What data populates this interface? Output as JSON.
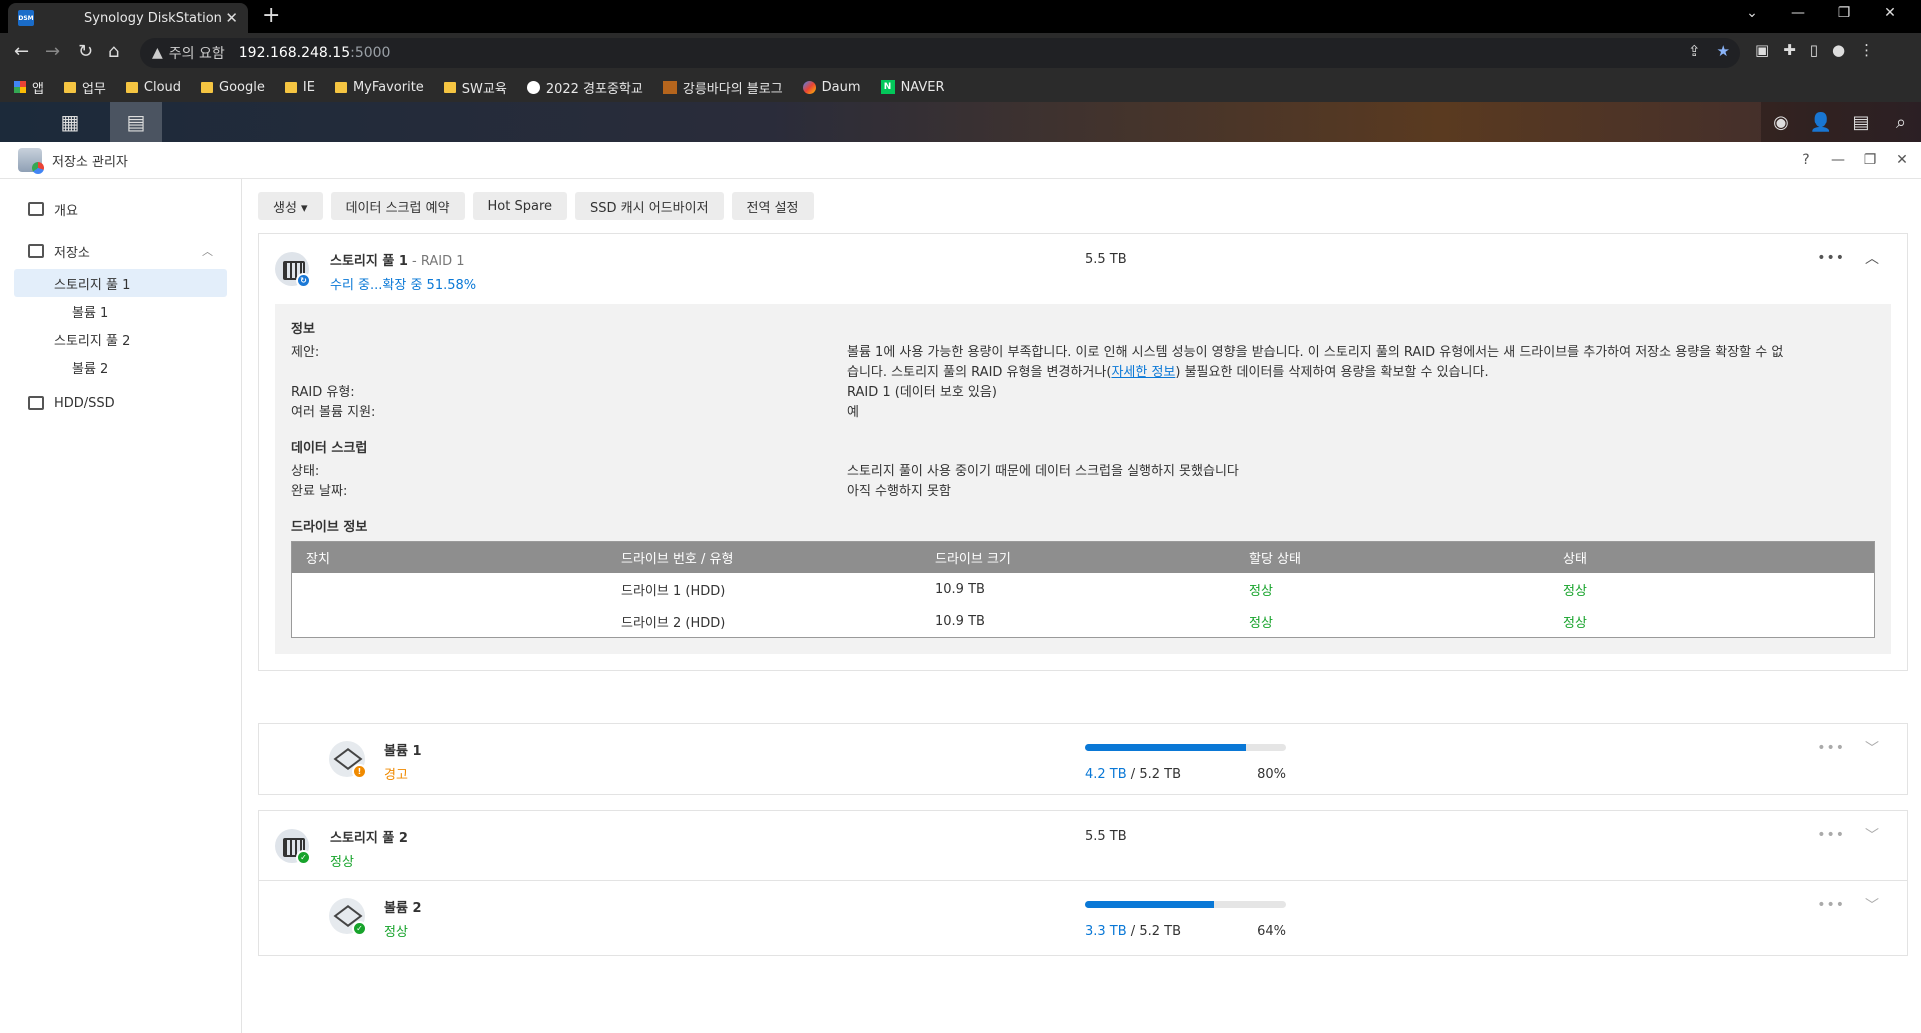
{
  "browser": {
    "tab_title": "Synology DiskStation",
    "tab_icon_text": "DSM",
    "security_text": "주의 요함",
    "host": "192.168.248.15",
    "port": ":5000",
    "bookmarks": [
      "앱",
      "업무",
      "Cloud",
      "Google",
      "IE",
      "MyFavorite",
      "SW교육",
      "2022 경포중학교",
      "강릉바다의 블로그",
      "Daum",
      "NAVER"
    ]
  },
  "app": {
    "title": "저장소 관리자"
  },
  "sidebar": {
    "overview": "개요",
    "storage": "저장소",
    "pool1": "스토리지 풀 1",
    "vol1": "볼륨 1",
    "pool2": "스토리지 풀 2",
    "vol2": "볼륨 2",
    "hdd": "HDD/SSD"
  },
  "toolbar": {
    "create": "생성 ▾",
    "scrub_schedule": "데이터 스크럽 예약",
    "hot_spare": "Hot Spare",
    "ssd_advisor": "SSD 캐시 어드바이저",
    "global_settings": "전역 설정"
  },
  "pool1": {
    "name": "스토리지 풀 1",
    "raid_sub": " - RAID 1",
    "status": "수리 중...확장 중 51.58%",
    "size": "5.5 TB",
    "info_title": "정보",
    "suggestion_label": "제안:",
    "suggestion_line1": "볼륨 1에 사용 가능한 용량이 부족합니다. 이로 인해 시스템 성능이 영향을 받습니다. 이 스토리지 풀의 RAID 유형에서는 새 드라이브를 추가하여 저장소 용량을 확장할 수 없",
    "suggestion_line2a": "습니다. 스토리지 풀의 RAID 유형을 변경하거나(",
    "suggestion_link": "자세한 정보",
    "suggestion_line2b": ") 불필요한 데이터를 삭제하여 용량을 확보할 수 있습니다.",
    "raid_label": "RAID 유형:",
    "raid_value": "RAID 1 (데이터 보호 있음)",
    "multivol_label": "여러 볼륨 지원:",
    "multivol_value": "예",
    "scrub_title": "데이터 스크럽",
    "scrub_status_label": "상태:",
    "scrub_status_value": "스토리지 풀이 사용 중이기 때문에 데이터 스크럽을 실행하지 못했습니다",
    "scrub_done_label": "완료 날짜:",
    "scrub_done_value": "아직 수행하지 못함",
    "drive_title": "드라이브 정보",
    "drive_headers": [
      "장치",
      "드라이브 번호 / 유형",
      "드라이브 크기",
      "할당 상태",
      "상태"
    ],
    "drives": [
      {
        "device": "",
        "num": "드라이브 1 (HDD)",
        "size": "10.9 TB",
        "alloc": "정상",
        "status": "정상"
      },
      {
        "device": "",
        "num": "드라이브 2 (HDD)",
        "size": "10.9 TB",
        "alloc": "정상",
        "status": "정상"
      }
    ]
  },
  "volume1": {
    "name": "볼륨 1",
    "status": "경고",
    "used": "4.2 TB",
    "total": " / 5.2 TB",
    "percent": "80%",
    "fill": 0.8
  },
  "pool2": {
    "name": "스토리지 풀 2",
    "status": "정상",
    "size": "5.5 TB"
  },
  "volume2": {
    "name": "볼륨 2",
    "status": "정상",
    "used": "3.3 TB",
    "total": " / 5.2 TB",
    "percent": "64%",
    "fill": 0.64
  }
}
